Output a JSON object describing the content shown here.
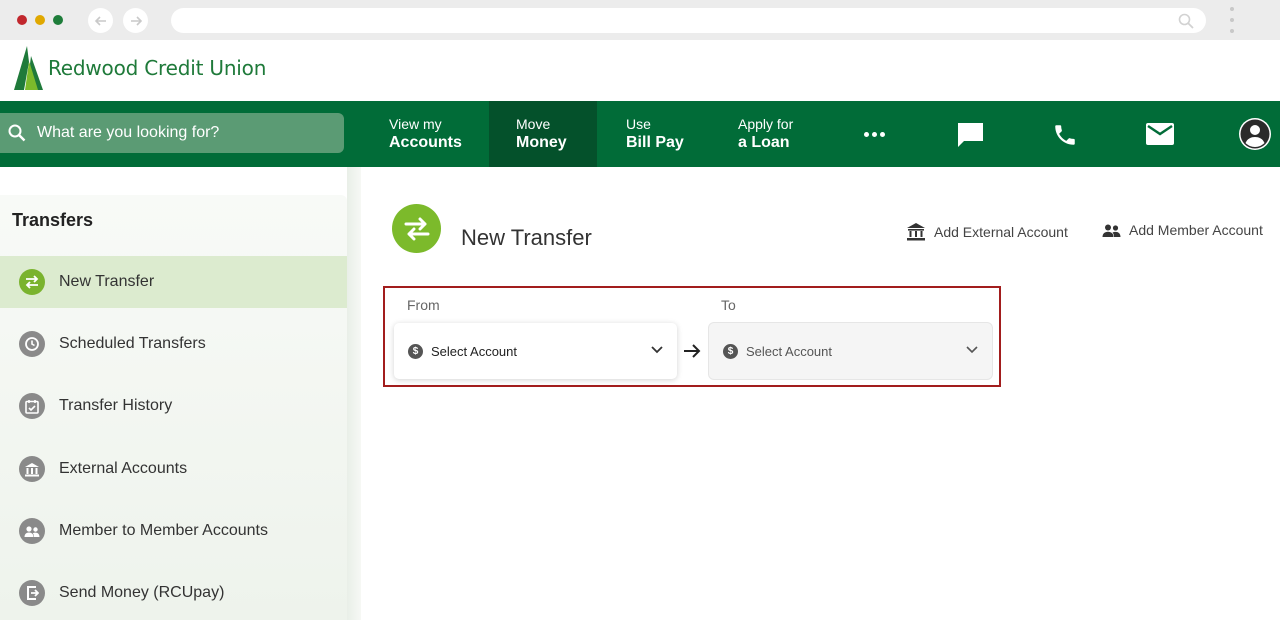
{
  "brand": {
    "name": "Redwood Credit Union",
    "color": "#016c38",
    "accent": "#7cba2b"
  },
  "search": {
    "placeholder": "What are you looking for?"
  },
  "nav": {
    "items": [
      {
        "line1": "View my",
        "line2": "Accounts"
      },
      {
        "line1": "Move",
        "line2": "Money"
      },
      {
        "line1": "Use",
        "line2": "Bill Pay"
      },
      {
        "line1": "Apply for",
        "line2": "a Loan"
      }
    ],
    "icons": [
      "more-icon",
      "chat-icon",
      "phone-icon",
      "mail-icon",
      "profile-icon"
    ]
  },
  "sidebar": {
    "title": "Transfers",
    "items": [
      {
        "label": "New Transfer",
        "icon": "transfer-icon",
        "active": true
      },
      {
        "label": "Scheduled Transfers",
        "icon": "clock-icon"
      },
      {
        "label": "Transfer History",
        "icon": "calendar-check-icon"
      },
      {
        "label": "External Accounts",
        "icon": "bank-icon"
      },
      {
        "label": "Member to Member Accounts",
        "icon": "people-icon"
      },
      {
        "label": "Send Money (RCUpay)",
        "icon": "send-money-icon"
      }
    ]
  },
  "main": {
    "title": "New Transfer",
    "actions": {
      "add_external": "Add External Account",
      "add_member": "Add Member Account"
    },
    "from": {
      "label": "From",
      "value": "Select Account"
    },
    "to": {
      "label": "To",
      "value": "Select Account"
    }
  }
}
